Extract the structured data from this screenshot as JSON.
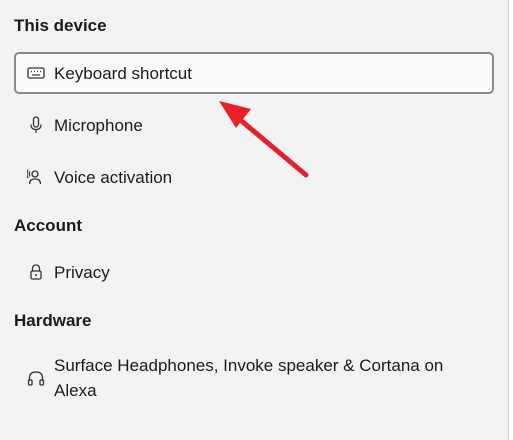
{
  "sections": [
    {
      "header": "This device",
      "items": [
        {
          "label": "Keyboard shortcut",
          "icon": "keyboard-icon",
          "selected": true
        },
        {
          "label": "Microphone",
          "icon": "microphone-icon",
          "selected": false
        },
        {
          "label": "Voice activation",
          "icon": "voice-activation-icon",
          "selected": false
        }
      ]
    },
    {
      "header": "Account",
      "items": [
        {
          "label": "Privacy",
          "icon": "lock-icon",
          "selected": false
        }
      ]
    },
    {
      "header": "Hardware",
      "items": [
        {
          "label": "Surface Headphones, Invoke speaker & Cortana on Alexa",
          "icon": "headphones-icon",
          "selected": false
        }
      ]
    }
  ],
  "colors": {
    "background": "#f3f3f3",
    "selected_border": "#8a8a8a",
    "arrow": "#e8202a"
  }
}
